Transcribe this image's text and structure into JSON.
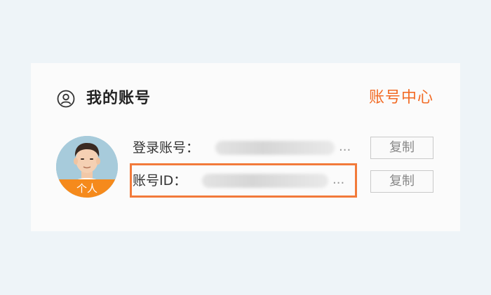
{
  "header": {
    "icon": "user-circle-icon",
    "title": "我的账号",
    "account_center_link": "账号中心"
  },
  "avatar": {
    "badge": "个人"
  },
  "rows": [
    {
      "label": "登录账号：",
      "value_state": "blurred",
      "ellipsis": "...",
      "copy_label": "复制"
    },
    {
      "label": "账号ID：",
      "value_state": "blurred",
      "ellipsis": "...",
      "copy_label": "复制",
      "highlighted": true
    }
  ],
  "colors": {
    "accent": "#f26b25",
    "highlight_border": "#f27a3a",
    "badge": "#f58a1c",
    "background": "#eef4f8"
  }
}
